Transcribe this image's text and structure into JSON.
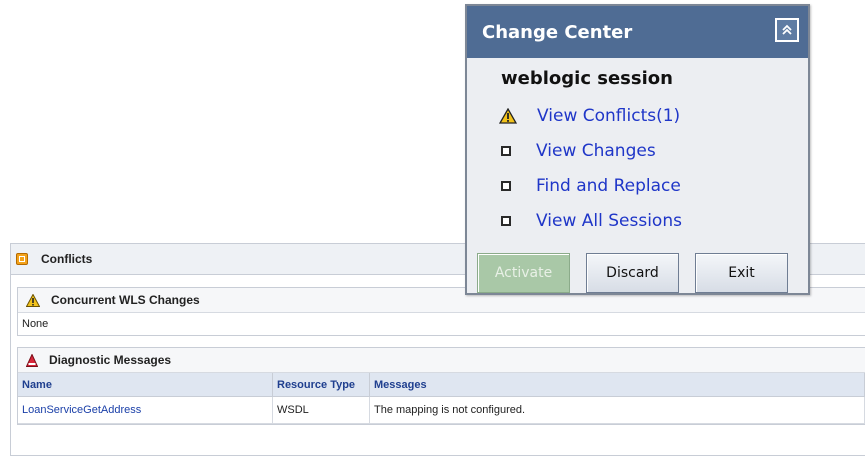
{
  "change_center": {
    "title": "Change Center",
    "collapse_icon": "chevron-up-icon",
    "session_label": "weblogic session",
    "links": [
      {
        "label": "View Conflicts(1)",
        "icon": "warning-icon"
      },
      {
        "label": "View Changes",
        "icon": "square-bullet-icon"
      },
      {
        "label": "Find and Replace",
        "icon": "square-bullet-icon"
      },
      {
        "label": "View All Sessions",
        "icon": "square-bullet-icon"
      }
    ],
    "buttons": {
      "activate": "Activate",
      "discard": "Discard",
      "exit": "Exit"
    },
    "colors": {
      "header": "#4f6c94",
      "link": "#1f36c8",
      "activate_disabled": "#a9c8a7"
    }
  },
  "conflicts": {
    "title": "Conflicts",
    "concurrent": {
      "title": "Concurrent WLS Changes",
      "body": "None"
    },
    "diagnostic": {
      "title": "Diagnostic Messages",
      "columns": [
        "Name",
        "Resource Type",
        "Messages"
      ],
      "rows": [
        {
          "name": "LoanServiceGetAddress",
          "resource_type": "WSDL",
          "message": "The mapping is not configured."
        }
      ]
    }
  }
}
